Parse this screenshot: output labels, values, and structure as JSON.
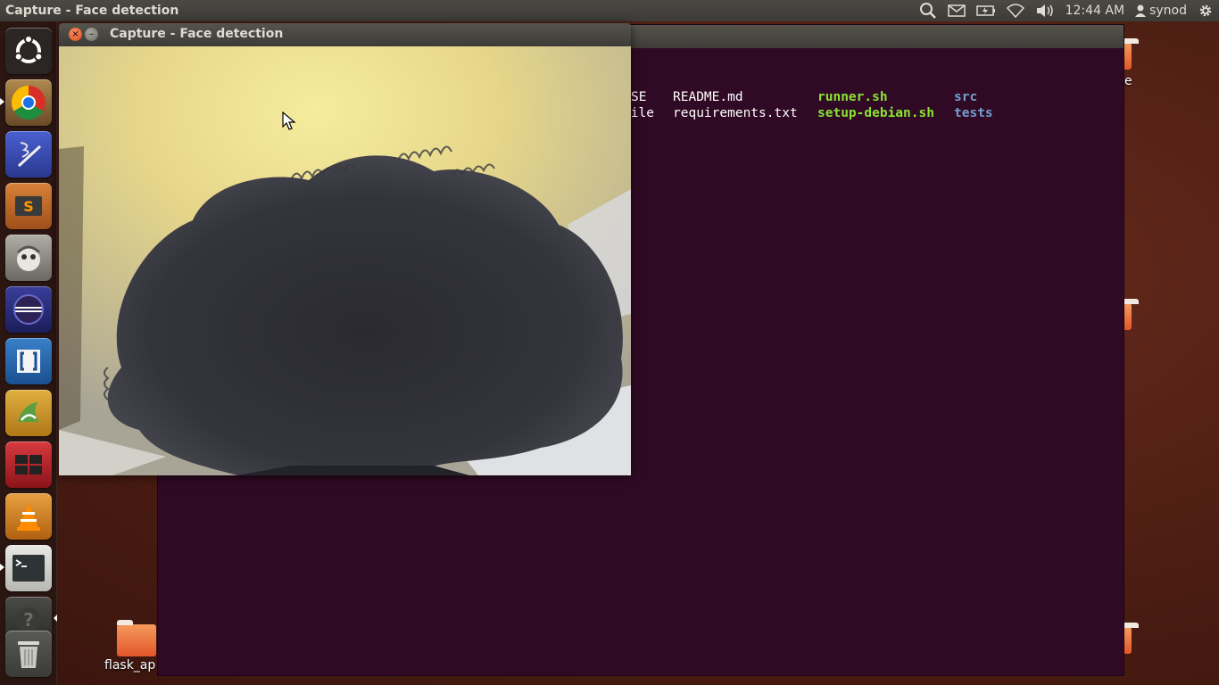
{
  "top_panel": {
    "active_window_title": "Capture - Face detection",
    "clock": "12:44 AM",
    "username": "synod",
    "indicator_icons": [
      "search-icon",
      "mail-icon",
      "battery-icon",
      "wifi-icon",
      "volume-icon",
      "user-icon",
      "gear-icon"
    ]
  },
  "launcher": {
    "items": [
      {
        "name": "ubuntu-dash",
        "icon": "ubuntu-logo-icon",
        "color": "#2b2b2b"
      },
      {
        "name": "chromium",
        "icon": "chrome-icon",
        "color": "#8a6a3a"
      },
      {
        "name": "text-editor",
        "icon": "pen-icon",
        "color": "#3a4fb8"
      },
      {
        "name": "sublime-text",
        "icon": "sublime-icon",
        "color": "#c46a2a"
      },
      {
        "name": "gimp",
        "icon": "gimp-icon",
        "color": "#8a8a84"
      },
      {
        "name": "eclipse",
        "icon": "eclipse-icon",
        "color": "#2a2e7a"
      },
      {
        "name": "brackets",
        "icon": "brackets-icon",
        "color": "#2a6ab0"
      },
      {
        "name": "pycharm",
        "icon": "pycharm-icon",
        "color": "#d8a030"
      },
      {
        "name": "workspace-switcher",
        "icon": "workspaces-icon",
        "color": "#b8282e"
      },
      {
        "name": "vlc",
        "icon": "vlc-cone-icon",
        "color": "#d88a20"
      },
      {
        "name": "terminal",
        "icon": "terminal-icon",
        "color": "#555753"
      },
      {
        "name": "help",
        "icon": "help-icon",
        "color": "#3a3a36"
      },
      {
        "name": "trash",
        "icon": "trash-icon",
        "color": "#6a6a66"
      }
    ]
  },
  "desktop": {
    "folder_label": "flask_ap",
    "right_label_fragment": "e"
  },
  "terminal": {
    "listing": [
      {
        "text": "SE",
        "kind": "file"
      },
      {
        "text": "README.md",
        "kind": "file"
      },
      {
        "text": "runner.sh",
        "kind": "exec"
      },
      {
        "text": "src",
        "kind": "dir"
      },
      {
        "text": "file",
        "kind": "file"
      },
      {
        "text": "requirements.txt",
        "kind": "file"
      },
      {
        "text": "setup-debian.sh",
        "kind": "exec"
      },
      {
        "text": "tests",
        "kind": "dir"
      }
    ]
  },
  "capture_window": {
    "title": "Capture - Face detection",
    "close_glyph": "×",
    "minimize_glyph": "–"
  },
  "colors": {
    "terminal_bg": "#300a24",
    "exec_green": "#8ae234",
    "dir_blue": "#729fcf",
    "panel": "#3c3b37"
  }
}
